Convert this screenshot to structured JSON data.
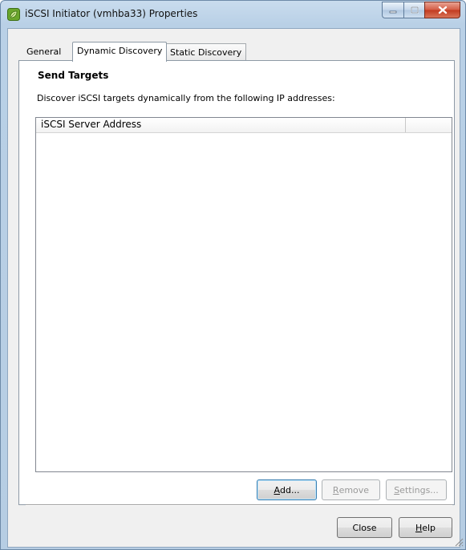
{
  "window": {
    "title": "iSCSI Initiator (vmhba33) Properties"
  },
  "tabs": [
    {
      "label": "General",
      "active": false
    },
    {
      "label": "Dynamic Discovery",
      "active": true
    },
    {
      "label": "Static Discovery",
      "active": false
    }
  ],
  "panel": {
    "heading": "Send Targets",
    "description": "Discover iSCSI targets dynamically from the following IP addresses:",
    "list": {
      "columns": [
        "iSCSI Server Address",
        ""
      ],
      "rows": []
    }
  },
  "panel_buttons": {
    "add": {
      "pre": "",
      "mnemonic": "A",
      "post": "dd...",
      "enabled": true
    },
    "remove": {
      "pre": "",
      "mnemonic": "R",
      "post": "emove",
      "enabled": false
    },
    "settings": {
      "pre": "",
      "mnemonic": "S",
      "post": "ettings...",
      "enabled": false
    }
  },
  "dialog_buttons": {
    "close": "Close",
    "help": {
      "pre": "",
      "mnemonic": "H",
      "post": "elp"
    }
  },
  "icons": {
    "app": "vsphere-leaf-icon",
    "minimize": "minimize-icon",
    "maximize": "maximize-icon",
    "close": "close-icon"
  },
  "colors": {
    "title_bar": "#b9d0e6",
    "close_button": "#c23a1f",
    "panel_bg": "#ffffff",
    "dialog_bg": "#f0f0f0"
  }
}
